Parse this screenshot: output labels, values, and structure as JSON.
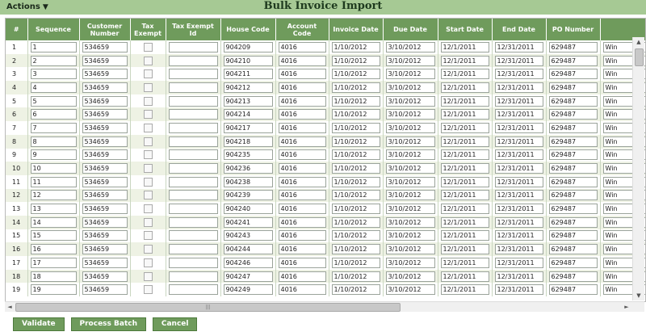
{
  "toolbar": {
    "actions_label": "Actions",
    "actions_caret": "▼"
  },
  "page": {
    "title": "Bulk Invoice Import"
  },
  "columns": [
    "#",
    "Sequence",
    "Customer Number",
    "Tax Exempt",
    "Tax Exempt Id",
    "House Code",
    "Account Code",
    "Invoice Date",
    "Due Date",
    "Start Date",
    "End Date",
    "PO Number",
    ""
  ],
  "rows": [
    {
      "n": "1",
      "seq": "1",
      "cust": "534659",
      "tax_id": "",
      "house": "904209",
      "acct": "4016",
      "inv": "1/10/2012",
      "due": "3/10/2012",
      "start": "12/1/2011",
      "end": "12/31/2011",
      "po": "629487",
      "extra": "Win"
    },
    {
      "n": "2",
      "seq": "2",
      "cust": "534659",
      "tax_id": "",
      "house": "904210",
      "acct": "4016",
      "inv": "1/10/2012",
      "due": "3/10/2012",
      "start": "12/1/2011",
      "end": "12/31/2011",
      "po": "629487",
      "extra": "Win"
    },
    {
      "n": "3",
      "seq": "3",
      "cust": "534659",
      "tax_id": "",
      "house": "904211",
      "acct": "4016",
      "inv": "1/10/2012",
      "due": "3/10/2012",
      "start": "12/1/2011",
      "end": "12/31/2011",
      "po": "629487",
      "extra": "Win"
    },
    {
      "n": "4",
      "seq": "4",
      "cust": "534659",
      "tax_id": "",
      "house": "904212",
      "acct": "4016",
      "inv": "1/10/2012",
      "due": "3/10/2012",
      "start": "12/1/2011",
      "end": "12/31/2011",
      "po": "629487",
      "extra": "Win"
    },
    {
      "n": "5",
      "seq": "5",
      "cust": "534659",
      "tax_id": "",
      "house": "904213",
      "acct": "4016",
      "inv": "1/10/2012",
      "due": "3/10/2012",
      "start": "12/1/2011",
      "end": "12/31/2011",
      "po": "629487",
      "extra": "Win"
    },
    {
      "n": "6",
      "seq": "6",
      "cust": "534659",
      "tax_id": "",
      "house": "904214",
      "acct": "4016",
      "inv": "1/10/2012",
      "due": "3/10/2012",
      "start": "12/1/2011",
      "end": "12/31/2011",
      "po": "629487",
      "extra": "Win"
    },
    {
      "n": "7",
      "seq": "7",
      "cust": "534659",
      "tax_id": "",
      "house": "904217",
      "acct": "4016",
      "inv": "1/10/2012",
      "due": "3/10/2012",
      "start": "12/1/2011",
      "end": "12/31/2011",
      "po": "629487",
      "extra": "Win"
    },
    {
      "n": "8",
      "seq": "8",
      "cust": "534659",
      "tax_id": "",
      "house": "904218",
      "acct": "4016",
      "inv": "1/10/2012",
      "due": "3/10/2012",
      "start": "12/1/2011",
      "end": "12/31/2011",
      "po": "629487",
      "extra": "Win"
    },
    {
      "n": "9",
      "seq": "9",
      "cust": "534659",
      "tax_id": "",
      "house": "904235",
      "acct": "4016",
      "inv": "1/10/2012",
      "due": "3/10/2012",
      "start": "12/1/2011",
      "end": "12/31/2011",
      "po": "629487",
      "extra": "Win"
    },
    {
      "n": "10",
      "seq": "10",
      "cust": "534659",
      "tax_id": "",
      "house": "904236",
      "acct": "4016",
      "inv": "1/10/2012",
      "due": "3/10/2012",
      "start": "12/1/2011",
      "end": "12/31/2011",
      "po": "629487",
      "extra": "Win"
    },
    {
      "n": "11",
      "seq": "11",
      "cust": "534659",
      "tax_id": "",
      "house": "904238",
      "acct": "4016",
      "inv": "1/10/2012",
      "due": "3/10/2012",
      "start": "12/1/2011",
      "end": "12/31/2011",
      "po": "629487",
      "extra": "Win"
    },
    {
      "n": "12",
      "seq": "12",
      "cust": "534659",
      "tax_id": "",
      "house": "904239",
      "acct": "4016",
      "inv": "1/10/2012",
      "due": "3/10/2012",
      "start": "12/1/2011",
      "end": "12/31/2011",
      "po": "629487",
      "extra": "Win"
    },
    {
      "n": "13",
      "seq": "13",
      "cust": "534659",
      "tax_id": "",
      "house": "904240",
      "acct": "4016",
      "inv": "1/10/2012",
      "due": "3/10/2012",
      "start": "12/1/2011",
      "end": "12/31/2011",
      "po": "629487",
      "extra": "Win"
    },
    {
      "n": "14",
      "seq": "14",
      "cust": "534659",
      "tax_id": "",
      "house": "904241",
      "acct": "4016",
      "inv": "1/10/2012",
      "due": "3/10/2012",
      "start": "12/1/2011",
      "end": "12/31/2011",
      "po": "629487",
      "extra": "Win"
    },
    {
      "n": "15",
      "seq": "15",
      "cust": "534659",
      "tax_id": "",
      "house": "904243",
      "acct": "4016",
      "inv": "1/10/2012",
      "due": "3/10/2012",
      "start": "12/1/2011",
      "end": "12/31/2011",
      "po": "629487",
      "extra": "Win"
    },
    {
      "n": "16",
      "seq": "16",
      "cust": "534659",
      "tax_id": "",
      "house": "904244",
      "acct": "4016",
      "inv": "1/10/2012",
      "due": "3/10/2012",
      "start": "12/1/2011",
      "end": "12/31/2011",
      "po": "629487",
      "extra": "Win"
    },
    {
      "n": "17",
      "seq": "17",
      "cust": "534659",
      "tax_id": "",
      "house": "904246",
      "acct": "4016",
      "inv": "1/10/2012",
      "due": "3/10/2012",
      "start": "12/1/2011",
      "end": "12/31/2011",
      "po": "629487",
      "extra": "Win"
    },
    {
      "n": "18",
      "seq": "18",
      "cust": "534659",
      "tax_id": "",
      "house": "904247",
      "acct": "4016",
      "inv": "1/10/2012",
      "due": "3/10/2012",
      "start": "12/1/2011",
      "end": "12/31/2011",
      "po": "629487",
      "extra": "Win"
    },
    {
      "n": "19",
      "seq": "19",
      "cust": "534659",
      "tax_id": "",
      "house": "904249",
      "acct": "4016",
      "inv": "1/10/2012",
      "due": "3/10/2012",
      "start": "12/1/2011",
      "end": "12/31/2011",
      "po": "629487",
      "extra": "Win"
    }
  ],
  "buttons": {
    "validate": "Validate",
    "process": "Process Batch",
    "cancel": "Cancel"
  },
  "colors": {
    "accent": "#6f9b5c",
    "topbar": "#a6c994",
    "alt_row": "#eef2e4"
  }
}
